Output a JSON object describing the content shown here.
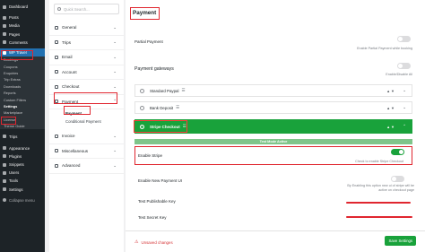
{
  "wp_menu": {
    "items_top": [
      {
        "label": "Dashboard",
        "icon": "dashboard-icon"
      },
      {
        "label": "Posts",
        "icon": "pin-icon"
      },
      {
        "label": "Media",
        "icon": "media-icon"
      },
      {
        "label": "Pages",
        "icon": "page-icon"
      },
      {
        "label": "Comments",
        "icon": "comment-icon"
      }
    ],
    "wp_travel": {
      "label": "WP Travel",
      "icon": "travel-icon"
    },
    "submenu": [
      "Bookings",
      "Coupons",
      "Enquiries",
      "Trip Extras",
      "Downloads",
      "Reports",
      "Custom Filters",
      "Settings",
      "Marketplace",
      "License",
      "Theme Guide"
    ],
    "submenu_current": "Settings",
    "items_bottom": [
      {
        "label": "Trips",
        "icon": "trips-icon"
      },
      {
        "label": "Appearance",
        "icon": "appearance-icon"
      },
      {
        "label": "Plugins",
        "icon": "plugin-icon"
      },
      {
        "label": "Snippets",
        "icon": "snippet-icon"
      },
      {
        "label": "Users",
        "icon": "users-icon"
      },
      {
        "label": "Tools",
        "icon": "tools-icon"
      },
      {
        "label": "Settings",
        "icon": "settings-icon"
      }
    ],
    "collapse": "Collapse menu"
  },
  "settings_nav": {
    "search_placeholder": "Quick Search...",
    "groups": [
      {
        "label": "General"
      },
      {
        "label": "Trips"
      },
      {
        "label": "Email"
      },
      {
        "label": "Account"
      },
      {
        "label": "Checkout"
      },
      {
        "label": "Payment"
      },
      {
        "label": "Invoice"
      },
      {
        "label": "Miscellaneous"
      },
      {
        "label": "Advanced"
      }
    ],
    "payment_subitems": [
      "Payment",
      "Conditional Payment"
    ]
  },
  "main": {
    "title": "Payment",
    "partial_payment": {
      "label": "Partial Payment",
      "hint": "Enable Partial Payment while booking",
      "enabled": false
    },
    "gateways_title": "Payment gateways",
    "enable_disable_all": "Enable/Disable All",
    "gateways": [
      {
        "name": "Standard Paypal",
        "active": false
      },
      {
        "name": "Bank Deposit",
        "active": false
      },
      {
        "name": "Stripe Checkout",
        "active": true
      }
    ],
    "test_mode_banner": "Test Mode Active",
    "enable_stripe": {
      "label": "Enable Stripe",
      "hint": "Check to enable Stripe Checkout",
      "enabled": true
    },
    "enable_new_payment_ui": {
      "label": "Enable New Payment UI",
      "hint": "By Enabling this option new ui of stripe will be active on checkout page",
      "enabled": false
    },
    "test_publishable_key": {
      "label": "Test Publishable Key"
    },
    "test_secret_key": {
      "label": "Test Secret Key"
    },
    "unsaved_changes": "Unsaved changes",
    "save_button": "Save Settings"
  },
  "colors": {
    "accent_green": "#19a23b",
    "highlight_red": "#e0262f",
    "wp_blue": "#2271b1",
    "wp_dark": "#1d2327"
  }
}
